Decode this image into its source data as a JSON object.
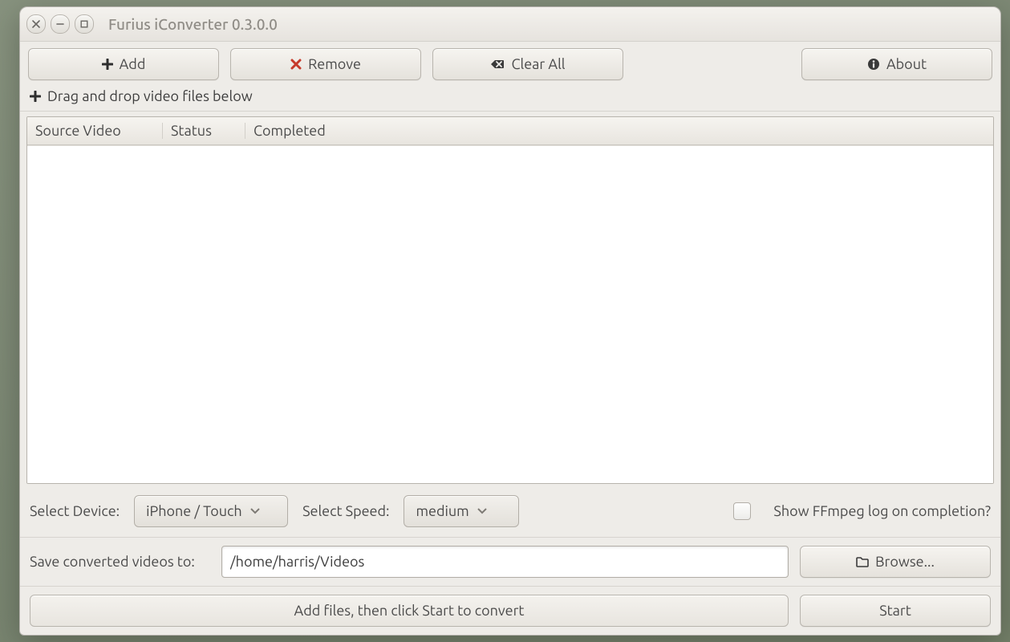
{
  "window": {
    "title": "Furius iConverter 0.3.0.0"
  },
  "toolbar": {
    "add": "Add",
    "remove": "Remove",
    "clear_all": "Clear All",
    "about": "About"
  },
  "drag_hint": "Drag and drop video files below",
  "table": {
    "columns": {
      "source": "Source Video",
      "status": "Status",
      "completed": "Completed"
    }
  },
  "options": {
    "device_label": "Select Device:",
    "device_value": "iPhone / Touch",
    "speed_label": "Select Speed:",
    "speed_value": "medium",
    "show_log_label": "Show FFmpeg log on completion?",
    "show_log_checked": false
  },
  "save_row": {
    "label": "Save converted videos to:",
    "path": "/home/harris/Videos",
    "browse": "Browse..."
  },
  "footer": {
    "progress_text": "Add files, then click Start to convert",
    "start": "Start"
  }
}
